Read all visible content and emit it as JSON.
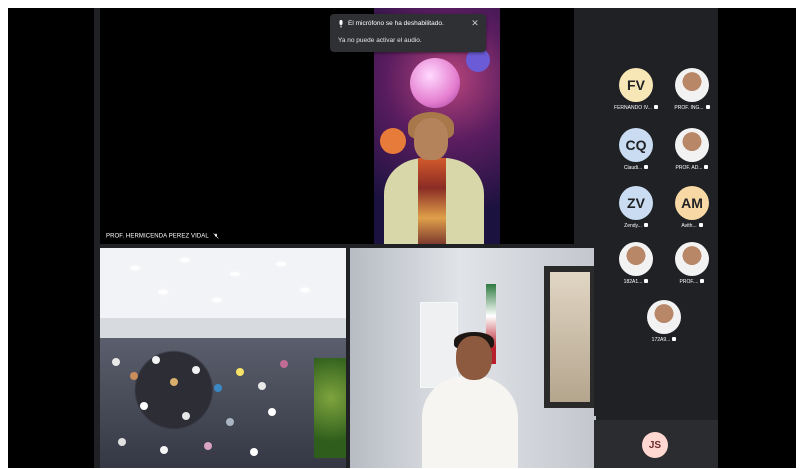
{
  "notification": {
    "title": "El micrófono se ha deshabilitado.",
    "subtitle": "Ya no puede activar el audio."
  },
  "tiles": {
    "main_label": "PROF. HERMICENDA PEREZ VIDAL",
    "room_label": "",
    "office_label": ""
  },
  "participants": [
    {
      "initials": "FV",
      "name": "FERNANDO IV...",
      "type": "initials",
      "color": "#f8e7b6"
    },
    {
      "initials": "",
      "name": "PROF. ING...",
      "type": "photo",
      "color": "#ffffff"
    },
    {
      "initials": "CQ",
      "name": "Claudi...",
      "type": "initials",
      "color": "#c9dcf2"
    },
    {
      "initials": "",
      "name": "PROF. AD...",
      "type": "photo",
      "color": "#ffffff"
    },
    {
      "initials": "ZV",
      "name": "Zendy...",
      "type": "initials",
      "color": "#c9dcf2"
    },
    {
      "initials": "AM",
      "name": "Avith...",
      "type": "initials",
      "color": "#f8d9a5"
    },
    {
      "initials": "",
      "name": "182A1...",
      "type": "photo",
      "color": "#ffffff"
    },
    {
      "initials": "",
      "name": "PROF....",
      "type": "photo",
      "color": "#ffffff"
    },
    {
      "initials": "",
      "name": "172A9...",
      "type": "photo",
      "color": "#ffffff"
    }
  ],
  "bottom_participant": {
    "initials": "JS"
  }
}
